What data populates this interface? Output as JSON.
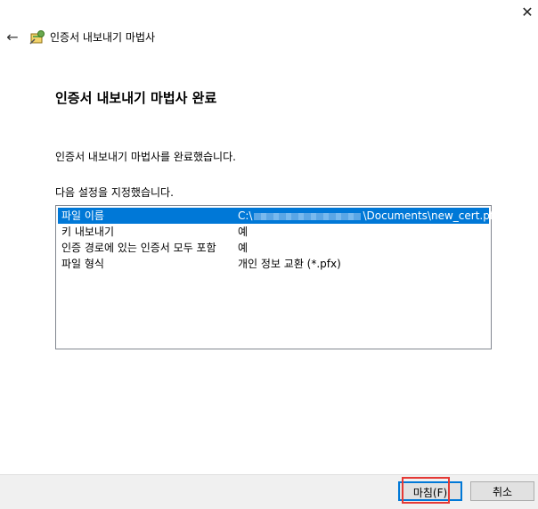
{
  "window": {
    "title": "인증서 내보내기 마법사",
    "close_glyph": "✕",
    "back_glyph": "←"
  },
  "page": {
    "title": "인증서 내보내기 마법사 완료",
    "completed_text": "인증서 내보내기 마법사를 완료했습니다.",
    "settings_label": "다음 설정을 지정했습니다."
  },
  "settings": [
    {
      "key": "파일 이름",
      "value_prefix": "C:\\",
      "value_suffix": "\\Documents\\new_cert.pfx"
    },
    {
      "key": "키 내보내기",
      "value": "예"
    },
    {
      "key": "인증 경로에 있는 인증서 모두 포함",
      "value": "예"
    },
    {
      "key": "파일 형식",
      "value": "개인 정보 교환 (*.pfx)"
    }
  ],
  "buttons": {
    "finish": "마침(F)",
    "cancel": "취소"
  },
  "colors": {
    "selection": "#0078d7",
    "highlight": "#e53935"
  }
}
